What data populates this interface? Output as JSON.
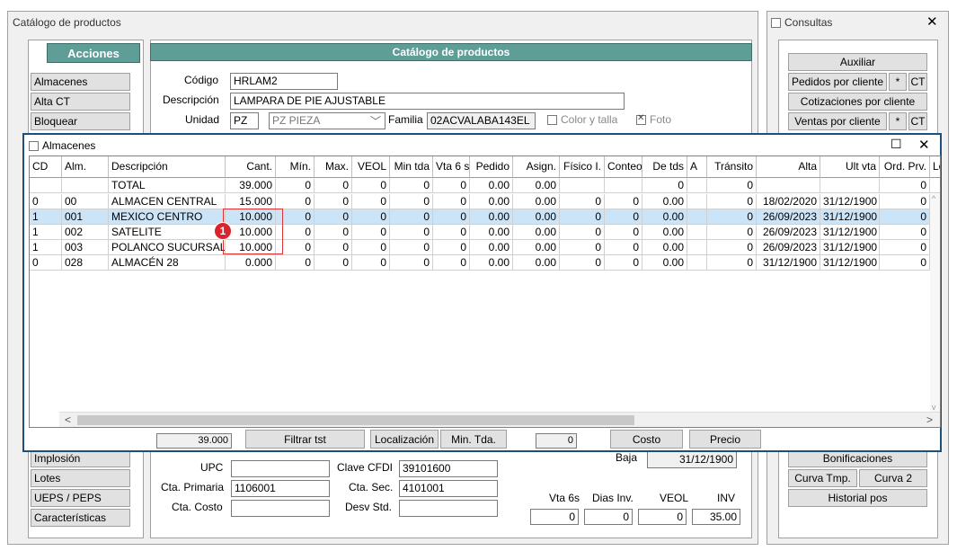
{
  "main_window": {
    "title": "Catálogo de productos"
  },
  "acciones": {
    "title": "Acciones"
  },
  "catalogo_header": "Catálogo de productos",
  "left_menu_top": [
    "Almacenes",
    "Alta CT",
    "Bloquear"
  ],
  "left_menu_bottom": [
    "Implosión",
    "Lotes",
    "UEPS / PEPS",
    "Características"
  ],
  "form": {
    "codigo_label": "Código",
    "codigo": "HRLAM2",
    "descripcion_label": "Descripción",
    "descripcion": "LAMPARA DE PIE AJUSTABLE",
    "unidad_label": "Unidad",
    "unidad": "PZ",
    "unidad_select": "PZ  PIEZA",
    "familia_label": "Familia",
    "familia": "02ACVALABA143EL",
    "color_talla": "Color y talla",
    "foto": "Foto",
    "upc_label": "UPC",
    "upc": "",
    "cta_primaria_label": "Cta. Primaria",
    "cta_primaria": "1106001",
    "cta_costo_label": "Cta. Costo",
    "cta_costo": "",
    "clave_cfdi_label": "Clave CFDI",
    "clave_cfdi": "39101600",
    "cta_sec_label": "Cta. Sec.",
    "cta_sec": "4101001",
    "desv_std_label": "Desv Std.",
    "desv_std": "",
    "baja_label": "Baja",
    "baja": "31/12/1900",
    "vta6s_label": "Vta 6s",
    "vta6s": "0",
    "dias_inv_label": "Dias Inv.",
    "dias_inv": "0",
    "veol_label": "VEOL",
    "veol": "0",
    "inv_label": "INV",
    "inv": "35.00"
  },
  "consultas": {
    "title": "Consultas",
    "auxiliar": "Auxiliar",
    "pedidos": "Pedidos por cliente",
    "star": "*",
    "ct": "CT",
    "cotizaciones": "Cotizaciones por cliente",
    "ventas": "Ventas por cliente",
    "bonificaciones": "Bonificaciones",
    "curva_tmp": "Curva Tmp.",
    "curva2": "Curva 2",
    "historial": "Historial pos"
  },
  "almacenes": {
    "title": "Almacenes",
    "headers": [
      "CD",
      "Alm.",
      "Descripción",
      "Cant.",
      "Mín.",
      "Max.",
      "VEOL",
      "Min tda",
      "Vta 6 s.",
      "Pedido",
      "Asign.",
      "Físico I.",
      "Conteo",
      "De tds",
      "A",
      "Tránsito",
      "Alta",
      "Ult vta",
      "Ord. Prv.",
      "Lo"
    ],
    "total": [
      "",
      "",
      "TOTAL",
      "39.000",
      "0",
      "0",
      "0",
      "0",
      "0",
      "0.00",
      "0.00",
      "",
      "",
      "0",
      "",
      "0",
      "",
      "",
      "0",
      ""
    ],
    "rows": [
      [
        "0",
        "00",
        "ALMACEN CENTRAL",
        "15.000",
        "0",
        "0",
        "0",
        "0",
        "0",
        "0.00",
        "0.00",
        "0",
        "0",
        "0.00",
        "",
        "0",
        "18/02/2020",
        "31/12/1900",
        "0",
        ""
      ],
      [
        "1",
        "001",
        "MEXICO CENTRO",
        "10.000",
        "0",
        "0",
        "0",
        "0",
        "0",
        "0.00",
        "0.00",
        "0",
        "0",
        "0.00",
        "",
        "0",
        "26/09/2023",
        "31/12/1900",
        "0",
        ""
      ],
      [
        "1",
        "002",
        "SATELITE",
        "10.000",
        "0",
        "0",
        "0",
        "0",
        "0",
        "0.00",
        "0.00",
        "0",
        "0",
        "0.00",
        "",
        "0",
        "26/09/2023",
        "31/12/1900",
        "0",
        ""
      ],
      [
        "1",
        "003",
        "POLANCO SUCURSAL",
        "10.000",
        "0",
        "0",
        "0",
        "0",
        "0",
        "0.00",
        "0.00",
        "0",
        "0",
        "0.00",
        "",
        "0",
        "26/09/2023",
        "31/12/1900",
        "0",
        ""
      ],
      [
        "0",
        "028",
        "ALMACÉN 28",
        "0.000",
        "0",
        "0",
        "0",
        "0",
        "0",
        "0.00",
        "0.00",
        "0",
        "0",
        "0.00",
        "",
        "0",
        "31/12/1900",
        "31/12/1900",
        "0",
        ""
      ]
    ],
    "footer": {
      "total": "39.000",
      "filtrar": "Filtrar tst",
      "localizacion": "Localización",
      "min_tda": "Min. Tda.",
      "zero": "0",
      "costo": "Costo",
      "precio": "Precio"
    },
    "badge": "1"
  }
}
